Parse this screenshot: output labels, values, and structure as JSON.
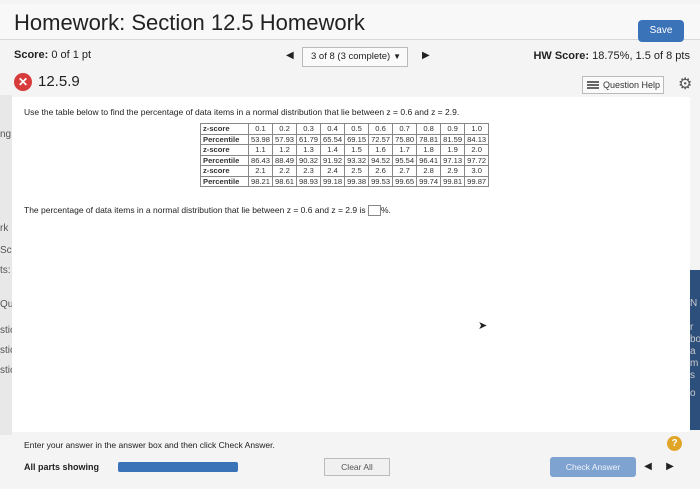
{
  "header": {
    "title": "Homework: Section 12.5 Homework",
    "save_label": "Save"
  },
  "score_bar": {
    "score_label": "Score:",
    "score_value": "0 of 1 pt",
    "progress_select": "3 of 8 (3 complete)",
    "hw_score_label": "HW Score:",
    "hw_score_value": "18.75%, 1.5 of 8 pts"
  },
  "question": {
    "number": "12.5.9",
    "help_label": "Question Help",
    "prompt": "Use the table below to find the percentage of data items in a normal distribution that lie between z = 0.6 and z = 2.9.",
    "table": [
      {
        "label": "z-score",
        "values": [
          "0.1",
          "0.2",
          "0.3",
          "0.4",
          "0.5",
          "0.6",
          "0.7",
          "0.8",
          "0.9",
          "1.0"
        ]
      },
      {
        "label": "Percentile",
        "values": [
          "53.98",
          "57.93",
          "61.79",
          "65.54",
          "69.15",
          "72.57",
          "75.80",
          "78.81",
          "81.59",
          "84.13"
        ]
      },
      {
        "label": "z-score",
        "values": [
          "1.1",
          "1.2",
          "1.3",
          "1.4",
          "1.5",
          "1.6",
          "1.7",
          "1.8",
          "1.9",
          "2.0"
        ]
      },
      {
        "label": "Percentile",
        "values": [
          "86.43",
          "88.49",
          "90.32",
          "91.92",
          "93.32",
          "94.52",
          "95.54",
          "96.41",
          "97.13",
          "97.72"
        ]
      },
      {
        "label": "z-score",
        "values": [
          "2.1",
          "2.2",
          "2.3",
          "2.4",
          "2.5",
          "2.6",
          "2.7",
          "2.8",
          "2.9",
          "3.0"
        ]
      },
      {
        "label": "Percentile",
        "values": [
          "98.21",
          "98.61",
          "98.93",
          "99.18",
          "99.38",
          "99.53",
          "99.65",
          "99.74",
          "99.81",
          "99.87"
        ]
      }
    ],
    "answer_prefix": "The percentage of data items in a normal distribution that lie between z = 0.6 and z = 2.9 is",
    "answer_value": "",
    "answer_suffix": "%."
  },
  "footer": {
    "instructions": "Enter your answer in the answer box and then click Check Answer.",
    "parts_label": "All parts showing",
    "parts_progress": 1.0,
    "clear_label": "Clear All",
    "check_label": "Check Answer"
  },
  "background": {
    "left_fragments": [
      "ng",
      "rk",
      "Sc",
      "ts:",
      "Qu",
      "stic",
      "stic",
      "stic"
    ],
    "right_fragments": [
      "N",
      "r",
      "bo",
      "a",
      "m",
      "s",
      "o"
    ]
  },
  "colors": {
    "accent": "#3b73b9",
    "error": "#d83b3b",
    "help": "#e0a526"
  }
}
